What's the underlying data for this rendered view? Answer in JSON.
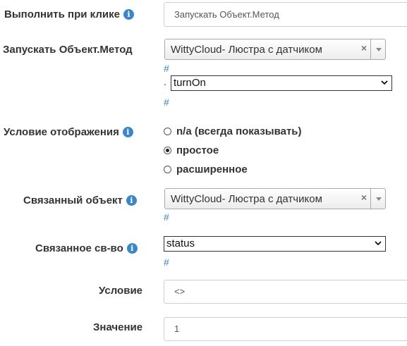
{
  "info_glyph": "i",
  "hash_glyph": "#",
  "dot_glyph": ".",
  "clear_glyph": "×",
  "icons": {
    "info": "info-icon",
    "clear": "close-icon",
    "dropdown": "chevron-down-icon"
  },
  "colors": {
    "accent": "#3b86c6",
    "text": "#333333",
    "border": "#cfcfcf"
  },
  "on_click": {
    "label": "Выполнить при клике",
    "value": "Запускать Объект.Метод"
  },
  "run_method": {
    "label": "Запускать Объект.Метод",
    "object_value": "WittyCloud- Люстра с датчиком",
    "method_value": "turnOn"
  },
  "display_condition": {
    "label": "Условие отображения",
    "options": [
      "n/a (всегда показывать)",
      "простое",
      "расширенное"
    ],
    "selected": "простое"
  },
  "linked_object": {
    "label": "Связанный объект",
    "value": "WittyCloud- Люстра с датчиком"
  },
  "linked_property": {
    "label": "Связанное св-во",
    "value": "status"
  },
  "condition": {
    "label": "Условие",
    "value": "<>"
  },
  "value_field": {
    "label": "Значение",
    "value": "1"
  }
}
